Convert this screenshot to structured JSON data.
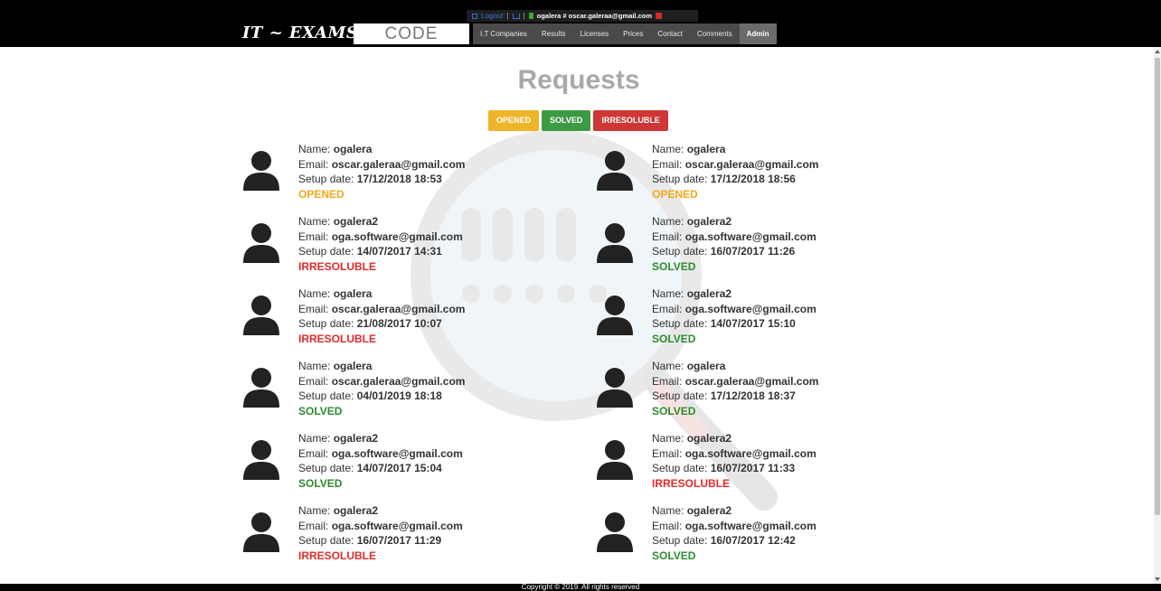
{
  "topbar": {
    "logout_label": "Logout",
    "separator": "|",
    "user_info": "ogalera # oscar.galeraa@gmail.com"
  },
  "header": {
    "logo_text": "IT ~ EXAMS",
    "code_label": "CODE",
    "nav": [
      {
        "label": "I.T Companies"
      },
      {
        "label": "Results"
      },
      {
        "label": "Licenses"
      },
      {
        "label": "Prices"
      },
      {
        "label": "Contact"
      },
      {
        "label": "Comments"
      },
      {
        "label": "Admin"
      }
    ]
  },
  "main": {
    "title": "Requests",
    "filters": {
      "opened": "OPENED",
      "solved": "SOLVED",
      "irresoluble": "IRRESOLUBLE"
    },
    "labels": {
      "name": "Name:",
      "email": "Email:",
      "setup": "Setup date:"
    },
    "requests": [
      {
        "name": "ogalera",
        "email": "oscar.galeraa@gmail.com",
        "date": "17/12/2018 18:53",
        "status": "OPENED"
      },
      {
        "name": "ogalera",
        "email": "oscar.galeraa@gmail.com",
        "date": "17/12/2018 18:56",
        "status": "OPENED"
      },
      {
        "name": "ogalera2",
        "email": "oga.software@gmail.com",
        "date": "14/07/2017 14:31",
        "status": "IRRESOLUBLE"
      },
      {
        "name": "ogalera2",
        "email": "oga.software@gmail.com",
        "date": "16/07/2017 11:26",
        "status": "SOLVED"
      },
      {
        "name": "ogalera",
        "email": "oscar.galeraa@gmail.com",
        "date": "21/08/2017 10:07",
        "status": "IRRESOLUBLE"
      },
      {
        "name": "ogalera2",
        "email": "oga.software@gmail.com",
        "date": "14/07/2017 15:10",
        "status": "SOLVED"
      },
      {
        "name": "ogalera",
        "email": "oscar.galeraa@gmail.com",
        "date": "04/01/2019 18:18",
        "status": "SOLVED"
      },
      {
        "name": "ogalera",
        "email": "oscar.galeraa@gmail.com",
        "date": "17/12/2018 18:37",
        "status": "SOLVED"
      },
      {
        "name": "ogalera2",
        "email": "oga.software@gmail.com",
        "date": "14/07/2017 15:04",
        "status": "SOLVED"
      },
      {
        "name": "ogalera2",
        "email": "oga.software@gmail.com",
        "date": "16/07/2017 11:33",
        "status": "IRRESOLUBLE"
      },
      {
        "name": "ogalera2",
        "email": "oga.software@gmail.com",
        "date": "16/07/2017 11:29",
        "status": "IRRESOLUBLE"
      },
      {
        "name": "ogalera2",
        "email": "oga.software@gmail.com",
        "date": "16/07/2017 12:42",
        "status": "SOLVED"
      }
    ]
  },
  "footer": {
    "copyright": "Copyright © 2019. All rights reserved"
  },
  "colors": {
    "opened": "#f0b429",
    "solved": "#3d9a43",
    "irresoluble": "#cf3636"
  },
  "icons": {
    "avatar": "user-silhouette-icon",
    "watermark": "magnifier-icon"
  }
}
